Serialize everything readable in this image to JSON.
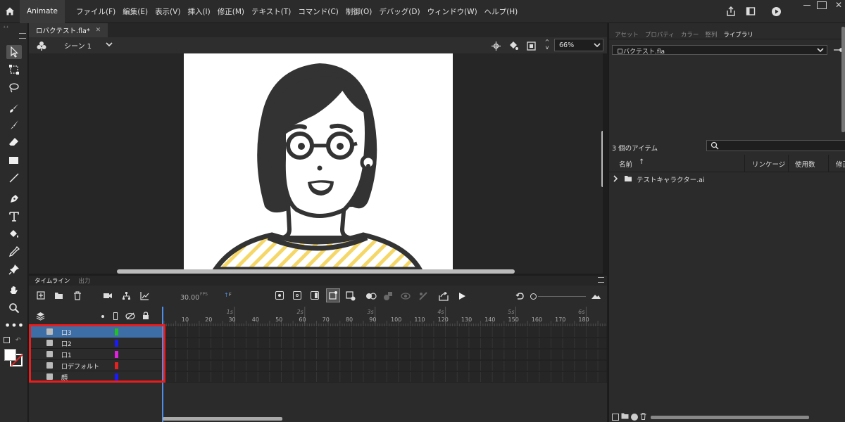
{
  "app": {
    "name": "Animate"
  },
  "menu": [
    "ファイル(F)",
    "編集(E)",
    "表示(V)",
    "挿入(I)",
    "修正(M)",
    "テキスト(T)",
    "コマンド(C)",
    "制御(O)",
    "デバッグ(D)",
    "ウィンドウ(W)",
    "ヘルプ(H)"
  ],
  "document": {
    "tab_label": "ロバクテスト.fla*",
    "scene": "シーン 1",
    "zoom": "66%"
  },
  "timeline": {
    "tabs": [
      "タイムライン",
      "出力"
    ],
    "fps": "30.00",
    "fps_unit": "FPS",
    "frame_label": "F",
    "seconds": [
      "1s",
      "2s",
      "3s",
      "4s",
      "5s",
      "6s"
    ],
    "frame_numbers": [
      "10",
      "20",
      "30",
      "40",
      "50",
      "60",
      "70",
      "80",
      "90",
      "100",
      "110",
      "120",
      "130",
      "140",
      "150",
      "160",
      "170",
      "180"
    ],
    "layers": [
      {
        "name": "口3",
        "color": "#23c022",
        "selected": true
      },
      {
        "name": "口2",
        "color": "#1a1aff",
        "selected": false
      },
      {
        "name": "口1",
        "color": "#e021e0",
        "selected": false
      },
      {
        "name": "口デフォルト",
        "color": "#e52222",
        "selected": false
      },
      {
        "name": "顔",
        "color": "#1a1aff",
        "selected": false
      }
    ],
    "highlight_color": "#ea1c1c"
  },
  "right_panel": {
    "tabs": [
      "アセット",
      "プロパティ",
      "カラー",
      "整列",
      "ライブラリ"
    ],
    "active_tab": "ライブラリ",
    "library_file": "ロバクテスト.fla",
    "item_count": "3 個のアイテム",
    "columns": {
      "name": "名前",
      "linkage": "リンケージ",
      "use_count": "使用数",
      "modified": "修正"
    },
    "items": [
      {
        "name": "テストキャラクター.ai",
        "type": "folder"
      }
    ]
  },
  "colors": {
    "accent_blue": "#4c8ee8",
    "selected_layer": "#3d6ea6"
  }
}
